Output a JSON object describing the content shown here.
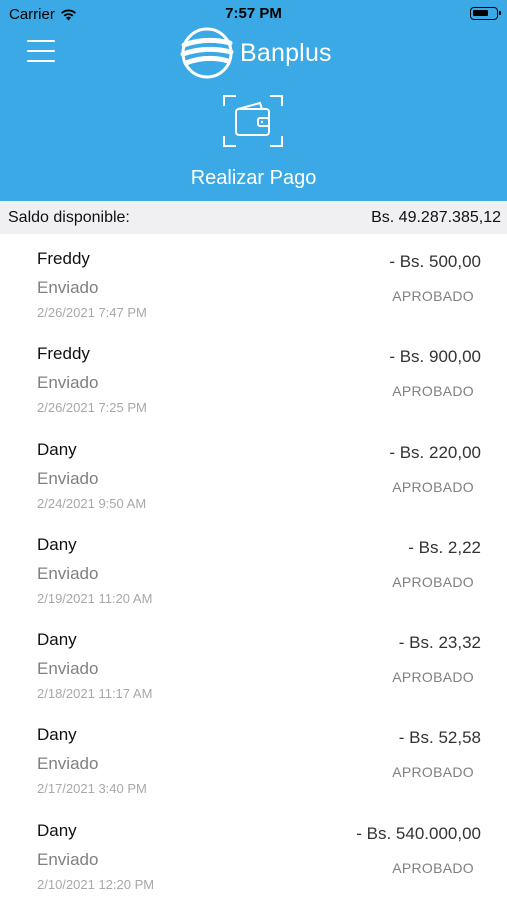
{
  "status_bar": {
    "carrier": "Carrier",
    "time": "7:57 PM"
  },
  "header": {
    "brand": "Banplus",
    "pay_label": "Realizar Pago",
    "color": "#3aa9e6"
  },
  "balance": {
    "label": "Saldo disponible:",
    "amount": "Bs. 49.287.385,12"
  },
  "transactions": [
    {
      "name": "Freddy",
      "type": "Enviado",
      "date": "2/26/2021 7:47 PM",
      "amount": "- Bs. 500,00",
      "status": "APROBADO"
    },
    {
      "name": "Freddy",
      "type": "Enviado",
      "date": "2/26/2021 7:25 PM",
      "amount": "- Bs. 900,00",
      "status": "APROBADO"
    },
    {
      "name": "Dany",
      "type": "Enviado",
      "date": "2/24/2021 9:50 AM",
      "amount": "- Bs. 220,00",
      "status": "APROBADO"
    },
    {
      "name": "Dany",
      "type": "Enviado",
      "date": "2/19/2021 11:20 AM",
      "amount": "- Bs. 2,22",
      "status": "APROBADO"
    },
    {
      "name": "Dany",
      "type": "Enviado",
      "date": "2/18/2021 11:17 AM",
      "amount": "- Bs. 23,32",
      "status": "APROBADO"
    },
    {
      "name": "Dany",
      "type": "Enviado",
      "date": "2/17/2021 3:40 PM",
      "amount": "- Bs. 52,58",
      "status": "APROBADO"
    },
    {
      "name": "Dany",
      "type": "Enviado",
      "date": "2/10/2021 12:20 PM",
      "amount": "- Bs. 540.000,00",
      "status": "APROBADO"
    }
  ]
}
